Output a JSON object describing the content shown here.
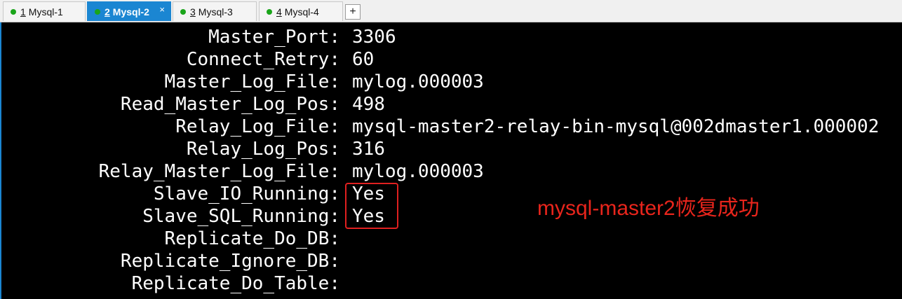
{
  "tabs": [
    {
      "num": "1",
      "label": "Mysql-1",
      "status_color": "#1aa51a",
      "active": false
    },
    {
      "num": "2",
      "label": "Mysql-2",
      "status_color": "#1aa51a",
      "active": true
    },
    {
      "num": "3",
      "label": "Mysql-3",
      "status_color": "#1aa51a",
      "active": false
    },
    {
      "num": "4",
      "label": "Mysql-4",
      "status_color": "#1aa51a",
      "active": false
    }
  ],
  "tab_close_glyph": "×",
  "add_tab_label": "+",
  "terminal": {
    "lines": [
      {
        "key": "Master_Port:",
        "value": "3306"
      },
      {
        "key": "Connect_Retry:",
        "value": "60"
      },
      {
        "key": "Master_Log_File:",
        "value": "mylog.000003"
      },
      {
        "key": "Read_Master_Log_Pos:",
        "value": "498"
      },
      {
        "key": "Relay_Log_File:",
        "value": "mysql-master2-relay-bin-mysql@002dmaster1.000002"
      },
      {
        "key": "Relay_Log_Pos:",
        "value": "316"
      },
      {
        "key": "Relay_Master_Log_File:",
        "value": "mylog.000003"
      },
      {
        "key": "Slave_IO_Running:",
        "value": "Yes"
      },
      {
        "key": "Slave_SQL_Running:",
        "value": "Yes"
      },
      {
        "key": "Replicate_Do_DB:",
        "value": ""
      },
      {
        "key": "Replicate_Ignore_DB:",
        "value": ""
      },
      {
        "key": "Replicate_Do_Table:",
        "value": ""
      }
    ]
  },
  "annotation": {
    "text": "mysql-master2恢复成功",
    "color": "#e8251c"
  },
  "colors": {
    "tab_active": "#1b86d2",
    "background": "#000000",
    "text": "#ffffff",
    "highlight_box": "#e02020"
  }
}
